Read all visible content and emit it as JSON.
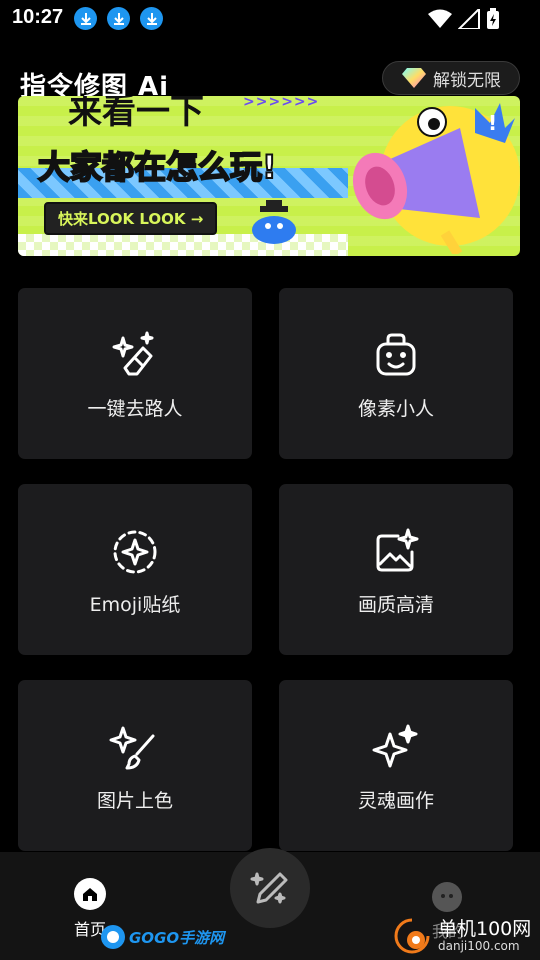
{
  "status_bar": {
    "time": "10:27"
  },
  "header": {
    "app_title": "指令修图 Ai",
    "unlock_label": "解锁无限"
  },
  "banner": {
    "line1": "来看一下",
    "line2": "大家都在怎么玩!",
    "cta": "快来LOOK LOOK →",
    "arrows": ">>>>>>"
  },
  "features": [
    {
      "label": "一键去路人",
      "icon": "magic-eraser-icon"
    },
    {
      "label": "像素小人",
      "icon": "robot-face-icon"
    },
    {
      "label": "Emoji贴纸",
      "icon": "sparkle-circle-icon"
    },
    {
      "label": "画质高清",
      "icon": "image-sparkle-icon"
    },
    {
      "label": "图片上色",
      "icon": "sparkle-brush-icon"
    },
    {
      "label": "灵魂画作",
      "icon": "sparkles-icon"
    }
  ],
  "nav": {
    "home_label": "首页",
    "mine_label": "我的"
  },
  "watermark": {
    "left": "GOGO手游网",
    "right_cn": "单机100网",
    "right_url": "danji100.com"
  },
  "colors": {
    "accent": "#1e96f0",
    "banner_bg": "#c8f04a",
    "card_bg": "#1c1c1e"
  }
}
